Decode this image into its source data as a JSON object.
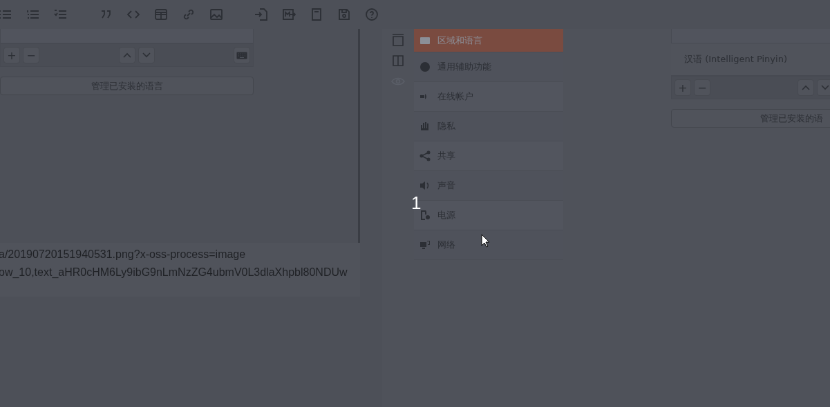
{
  "left_panel": {
    "toolbar_buttons": [
      "+",
      "−"
    ],
    "manage_button": "管理已安装的语言"
  },
  "source_text": [
    "a/20190720151940531.png?x-oss-process=image",
    "ow_10,text_aHR0cHM6Ly9ibG9nLmNzZG4ubmV0L3dlaXhpbl80NDUw"
  ],
  "settings_list": {
    "items": [
      {
        "label": "区域和语言",
        "selected": true
      },
      {
        "label": "通用辅助功能",
        "selected": false
      },
      {
        "label": "在线帐户",
        "selected": false
      },
      {
        "label": "隐私",
        "selected": false
      },
      {
        "label": "共享",
        "selected": false
      },
      {
        "label": "声音",
        "selected": false
      },
      {
        "label": "电源",
        "selected": false
      },
      {
        "label": "网络",
        "selected": false
      }
    ]
  },
  "step_number": "1",
  "right_panel": {
    "input_sources": [
      {
        "label": "汉语 (Intelligent Pinyin)"
      }
    ],
    "toolbar_buttons": [
      "+",
      "−"
    ],
    "manage_button": "管理已安装的语"
  }
}
